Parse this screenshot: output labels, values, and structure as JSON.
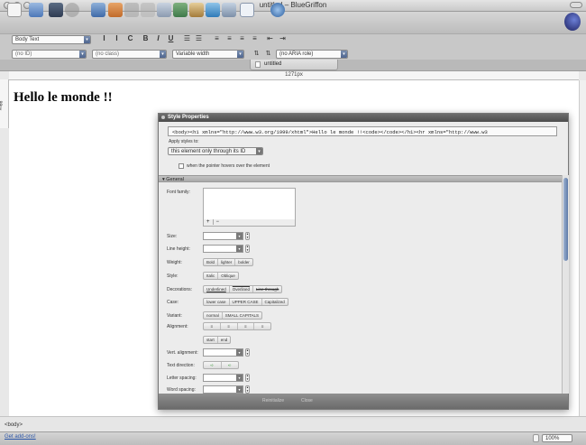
{
  "window": {
    "title": "untitled – BlueGriffon"
  },
  "toolbar": {
    "icons": [
      "new-document-icon",
      "open-icon",
      "save-icon",
      "stop-icon",
      "layout-icon",
      "image-icon",
      "anchor-icon",
      "link-icon",
      "table-icon",
      "form-icon",
      "styles-icon",
      "web-icon",
      "view-icon",
      "mozilla-icon"
    ]
  },
  "format": {
    "paragraph_style": "Body Text",
    "id_placeholder": "(no ID)",
    "class_placeholder": "(no class)",
    "width_mode": "Variable width",
    "aria_role": "(no ARIA role)"
  },
  "tabs": [
    {
      "label": "untitled"
    }
  ],
  "ruler": {
    "width_label": "1271px",
    "height_label": "98px"
  },
  "document": {
    "heading": "Hello le monde !!"
  },
  "status": {
    "path": "<body>",
    "addons_link": "Get add-ons!",
    "zoom": "100%"
  },
  "style_panel": {
    "title": "Style Properties",
    "source": "<body><h1 xmlns=\"http://www.w3.org/1999/xhtml\">Hello le monde !!<code></code></h1><hr xmlns=\"http://www.w3",
    "apply_label": "Apply styles to:",
    "apply_value": "this element only through its ID",
    "hover_label": "when the pointer hovers over the element",
    "section_general": "General",
    "labels": {
      "font_family": "Font family:",
      "size": "Size:",
      "line_height": "Line height:",
      "weight": "Weight:",
      "style": "Style:",
      "decorations": "Decorations:",
      "case": "Case:",
      "variant": "Variant:",
      "alignment": "Alignment:",
      "vert_alignment": "Vert. alignment:",
      "text_direction": "Text direction:",
      "letter_spacing": "Letter spacing:",
      "word_spacing": "Word spacing:"
    },
    "weight_options": [
      "Bold",
      "lighter",
      "bolder"
    ],
    "style_options": [
      "Italic",
      "Oblique"
    ],
    "decoration_options": [
      "Underlined",
      "Overlined",
      "Line-through"
    ],
    "case_options": [
      "lower case",
      "UPPER CASE",
      "Capitalized"
    ],
    "variant_options": [
      "normal",
      "SMALL CAPITALS"
    ],
    "alignment_extra": [
      "start",
      "end"
    ],
    "bottom_buttons": [
      "Reinitialize",
      "Close"
    ]
  }
}
